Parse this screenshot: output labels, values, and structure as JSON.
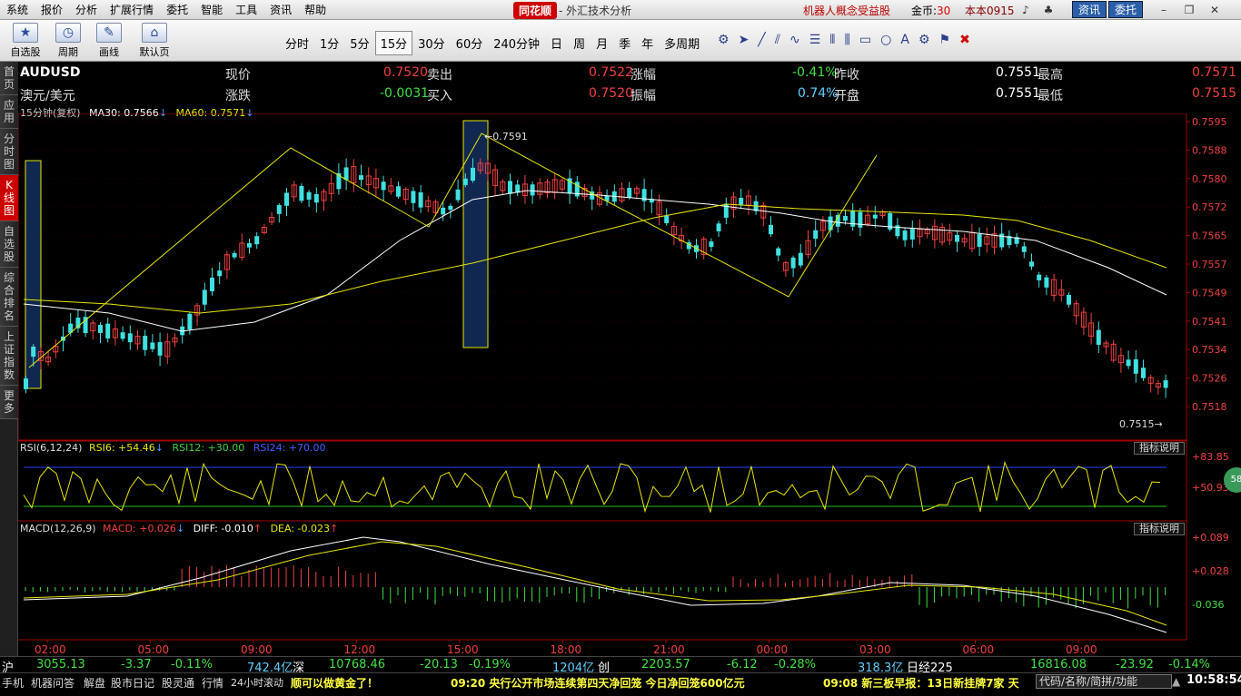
{
  "menu": [
    "系统",
    "报价",
    "分析",
    "扩展行情",
    "委托",
    "智能",
    "工具",
    "资讯",
    "帮助"
  ],
  "header": {
    "logo": "同花顺",
    "title": "- 外汇技术分析",
    "ad": "机器人概念受益股",
    "coins_label": "金币:",
    "coins_value": "30",
    "account": "本本0915",
    "btn_news": "资讯",
    "btn_trade": "委托"
  },
  "toolbar": {
    "buttons": [
      {
        "label": "自选股",
        "icon": "star-icon"
      },
      {
        "label": "周期",
        "icon": "clock-icon"
      },
      {
        "label": "画线",
        "icon": "pencil-icon"
      },
      {
        "label": "默认页",
        "icon": "home-icon"
      }
    ],
    "periods": [
      "分时",
      "1分",
      "5分",
      "15分",
      "30分",
      "60分",
      "240分钟",
      "日",
      "周",
      "月",
      "季",
      "年",
      "多周期"
    ],
    "active_period": "15分"
  },
  "sidebar_tabs": [
    "首页",
    "应用",
    "分时图",
    "K线图",
    "自选股",
    "综合排名",
    "上证指数",
    "更多"
  ],
  "active_tab": "K线图",
  "quote": {
    "symbol": "AUDUSD",
    "name": "澳元/美元",
    "labels": [
      "现价",
      "涨跌",
      "卖出",
      "买入",
      "涨幅",
      "振幅",
      "昨收",
      "开盘",
      "最高",
      "最低"
    ],
    "current": "0.7520",
    "change": "-0.0031",
    "ask": "0.7522",
    "bid": "0.7520",
    "change_pct": "-0.41%",
    "amplitude": "0.74%",
    "prev_close": "0.7551",
    "open": "0.7551",
    "high": "0.7571",
    "low": "0.7515"
  },
  "ma_line": {
    "period": "15分钟(复权)",
    "ma30": "MA30: 0.7566",
    "ma60": "MA60: 0.7571"
  },
  "price_axis": [
    "0.7595",
    "0.7588",
    "0.7580",
    "0.7572",
    "0.7565",
    "0.7557",
    "0.7549",
    "0.7541",
    "0.7534",
    "0.7526",
    "0.7518"
  ],
  "annotations": {
    "high": "0.7591",
    "low": "0.7515"
  },
  "rsi": {
    "title": "RSI(6,12,24)",
    "rsi6": "RSI6: +54.46",
    "rsi12": "RSI12: +30.00",
    "rsi24": "RSI24: +70.00",
    "axis": [
      "+83.85",
      "+50.93"
    ],
    "button": "指标说明"
  },
  "macd": {
    "title": "MACD(12,26,9)",
    "macd": "MACD: +0.026",
    "diff": "DIFF: -0.010",
    "dea": "DEA: -0.023",
    "axis": [
      "+0.089",
      "+0.028",
      "-0.036"
    ],
    "button": "指标说明"
  },
  "time_axis": [
    "02:00",
    "05:00",
    "09:00",
    "12:00",
    "15:00",
    "18:00",
    "21:00",
    "00:00",
    "03:00",
    "06:00",
    "09:00"
  ],
  "status": {
    "sh_label": "沪",
    "sh_index": "3055.13",
    "sh_chg": "-3.37",
    "sh_pct": "-0.11%",
    "sh_vol": "742.4亿",
    "sz_label": "深",
    "sz_index": "10768.46",
    "sz_chg": "-20.13",
    "sz_pct": "-0.19%",
    "sz_vol": "1204亿",
    "cy_label": "创",
    "cy_index": "2203.57",
    "cy_chg": "-6.12",
    "cy_pct": "-0.28%",
    "cy_vol": "318.3亿",
    "jp_label": "日经225",
    "jp_index": "16816.08",
    "jp_chg": "-23.92",
    "jp_pct": "-0.14%"
  },
  "bottom": {
    "tabs": [
      "手机",
      "机器问答",
      "解盘",
      "股市日记",
      "股灵通",
      "行情",
      "24小时滚动"
    ],
    "news1": "顺可以做黄金了！",
    "news2": "09:20 央行公开市场连续第四天净回笼 今日净回笼600亿元",
    "news3": "09:08 新三板早报：13日新挂牌7家 天",
    "search_placeholder": "代码/名称/简拼/功能",
    "clock": "10:58:54"
  },
  "bubble": "58",
  "colors": {
    "up": "#f04040",
    "down": "#40e0e0",
    "ma30": "#ffffff",
    "ma60": "#e6e600",
    "rsi6": "#e6e600",
    "highlight": "#1a3a6a"
  }
}
